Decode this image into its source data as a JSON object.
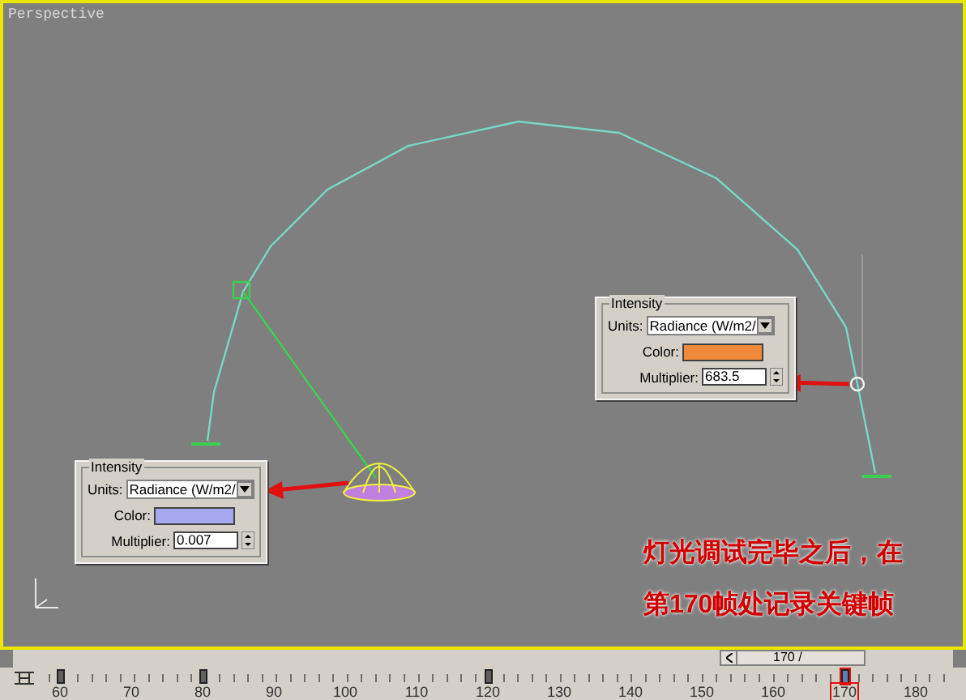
{
  "viewport": {
    "label": "Perspective"
  },
  "panels": [
    {
      "heading": "Intensity",
      "units_label": "Units:",
      "units_value": "Radiance (W/m2/",
      "color_label": "Color:",
      "color": "#f08a3a",
      "multiplier_label": "Multiplier:",
      "multiplier_value": "683.5"
    },
    {
      "heading": "Intensity",
      "units_label": "Units:",
      "units_value": "Radiance (W/m2/",
      "color_label": "Color:",
      "color": "#a8a8f0",
      "multiplier_label": "Multiplier:",
      "multiplier_value": "0.007"
    }
  ],
  "annotation": [
    "灯光调试完毕之后，在",
    "第170帧处记录关键帧"
  ],
  "time_slider": {
    "label": "170 /"
  },
  "timeline": [
    {
      "label": "60",
      "key": true,
      "selected": false
    },
    {
      "label": "70",
      "key": false,
      "selected": false
    },
    {
      "label": "80",
      "key": true,
      "selected": false
    },
    {
      "label": "90",
      "key": false,
      "selected": false
    },
    {
      "label": "100",
      "key": false,
      "selected": false
    },
    {
      "label": "110",
      "key": false,
      "selected": false
    },
    {
      "label": "120",
      "key": true,
      "selected": false
    },
    {
      "label": "130",
      "key": false,
      "selected": false
    },
    {
      "label": "140",
      "key": false,
      "selected": false
    },
    {
      "label": "150",
      "key": false,
      "selected": false
    },
    {
      "label": "160",
      "key": false,
      "selected": false
    },
    {
      "label": "170",
      "key": true,
      "selected": true
    },
    {
      "label": "180",
      "key": false,
      "selected": false
    }
  ]
}
